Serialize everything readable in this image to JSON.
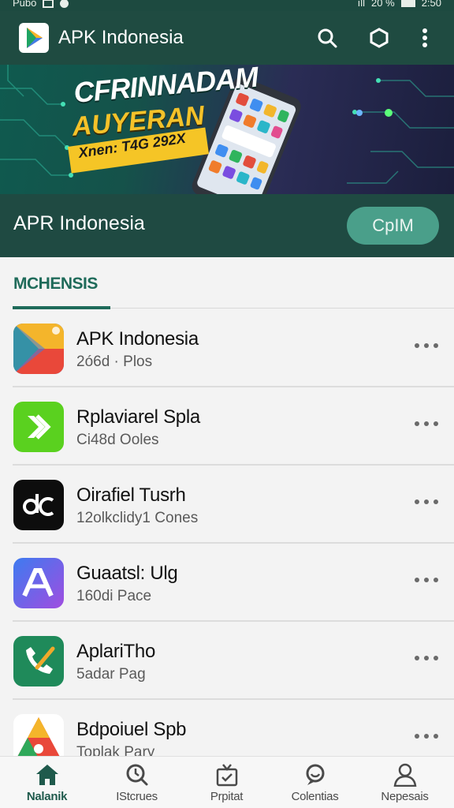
{
  "status_bar": {
    "left_text": "Pubo",
    "right_signal": "ıll",
    "battery_text": "20 %",
    "time": "2:50"
  },
  "app_bar": {
    "title": "APK Indonesia",
    "icons": [
      "play-logo-icon",
      "search-icon",
      "hexagon-icon",
      "more-vertical-icon"
    ]
  },
  "banner": {
    "line1": "CFRINNADAM",
    "line2": "AUYERAN",
    "line3": "Xnen: T4G 292X"
  },
  "hero": {
    "title": "APR Indonesia",
    "button_label": "CpIM"
  },
  "section": {
    "title": "MCHENSIS"
  },
  "apps": [
    {
      "name": "APK Indonesia",
      "sub": "2ó6d · Plos",
      "icon": "play-store-icon"
    },
    {
      "name": "Rplaviarel Spla",
      "sub": "Ci48d Ooles",
      "icon": "forward-arrow-icon"
    },
    {
      "name": "Oirafiel Tusrh",
      "sub": "12olkclidy1 Cones",
      "icon": "dc-logo-icon"
    },
    {
      "name": "Guaatsl: Ulg",
      "sub": "160di Pace",
      "icon": "a-letter-icon"
    },
    {
      "name": "AplariTho",
      "sub": "5adar Pag",
      "icon": "phone-leaf-icon"
    },
    {
      "name": "Bdpoiuel Spb",
      "sub": "Toplak Pary",
      "icon": "triangle-logo-icon"
    }
  ],
  "bottom_nav": [
    {
      "label": "Nalanik",
      "icon": "home-icon",
      "active": true
    },
    {
      "label": "IStcrues",
      "icon": "clock-search-icon",
      "active": false
    },
    {
      "label": "Prpitat",
      "icon": "tv-box-icon",
      "active": false
    },
    {
      "label": "Colentias",
      "icon": "chat-search-icon",
      "active": false
    },
    {
      "label": "Nepesais",
      "icon": "person-icon",
      "active": false
    }
  ],
  "colors": {
    "primary": "#1f4b41",
    "accent": "#1f6b5a",
    "button": "#4a9f8a",
    "banner_yellow": "#f5c526"
  }
}
